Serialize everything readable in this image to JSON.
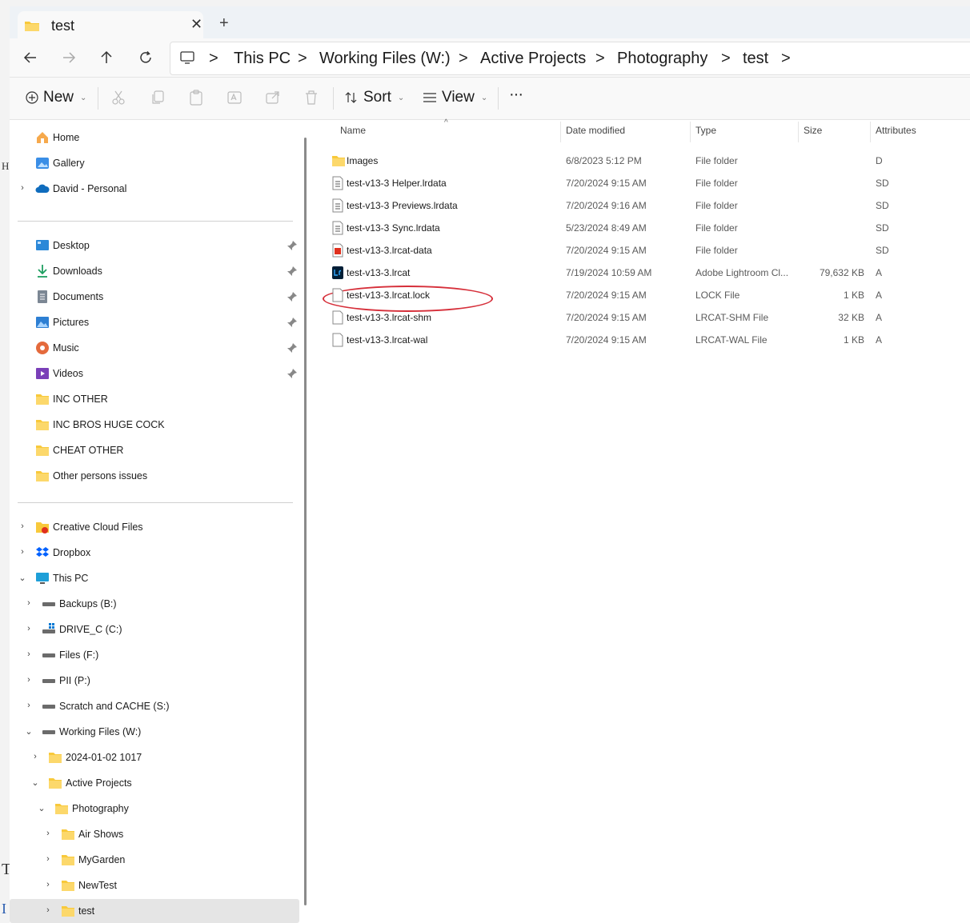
{
  "window": {
    "tab_title": "test",
    "tab_close": "✕",
    "new_tab": "+"
  },
  "addressbar": {
    "crumbs": [
      "This PC",
      "Working Files (W:)",
      "Active Projects",
      "Photography",
      "test"
    ],
    "sep": ">"
  },
  "commandbar": {
    "new_label": "New",
    "sort_label": "Sort",
    "view_label": "View",
    "more_label": "···"
  },
  "navpane": {
    "quick": [
      {
        "label": "Home",
        "icon": "home-icon"
      },
      {
        "label": "Gallery",
        "icon": "gallery-icon"
      },
      {
        "label": "David - Personal",
        "icon": "onedrive-icon"
      }
    ],
    "pinned": [
      {
        "label": "Desktop",
        "icon": "desktop-icon"
      },
      {
        "label": "Downloads",
        "icon": "downloads-icon"
      },
      {
        "label": "Documents",
        "icon": "documents-icon"
      },
      {
        "label": "Pictures",
        "icon": "pictures-icon"
      },
      {
        "label": "Music",
        "icon": "music-icon"
      },
      {
        "label": "Videos",
        "icon": "videos-icon"
      },
      {
        "label": "INC OTHER",
        "icon": "folder-icon"
      },
      {
        "label": "INC BROS HUGE COCK",
        "icon": "folder-icon"
      },
      {
        "label": "CHEAT OTHER",
        "icon": "folder-icon"
      },
      {
        "label": "Other persons issues",
        "icon": "folder-icon"
      }
    ],
    "tree": [
      {
        "label": "Creative Cloud Files",
        "icon": "creative-cloud-icon"
      },
      {
        "label": "Dropbox",
        "icon": "dropbox-icon"
      },
      {
        "label": "This PC",
        "icon": "this-pc-icon"
      },
      {
        "label": "Backups (B:)",
        "icon": "drive-icon"
      },
      {
        "label": "DRIVE_C (C:)",
        "icon": "windows-drive-icon"
      },
      {
        "label": "Files (F:)",
        "icon": "drive-icon"
      },
      {
        "label": "PII (P:)",
        "icon": "drive-icon"
      },
      {
        "label": "Scratch and CACHE (S:)",
        "icon": "drive-icon"
      },
      {
        "label": "Working Files (W:)",
        "icon": "drive-icon"
      },
      {
        "label": "2024-01-02 1017",
        "icon": "folder-icon"
      },
      {
        "label": "Active Projects",
        "icon": "folder-icon"
      },
      {
        "label": "Photography",
        "icon": "folder-icon"
      },
      {
        "label": "Air Shows",
        "icon": "folder-icon"
      },
      {
        "label": "MyGarden",
        "icon": "folder-icon"
      },
      {
        "label": "NewTest",
        "icon": "folder-icon"
      },
      {
        "label": "test",
        "icon": "folder-icon"
      }
    ]
  },
  "filelist": {
    "columns": [
      "Name",
      "Date modified",
      "Type",
      "Size",
      "Attributes"
    ],
    "rows": [
      {
        "name": "Images",
        "date": "6/8/2023 5:12 PM",
        "type": "File folder",
        "size": "",
        "attr": "D",
        "icon": "folder-icon"
      },
      {
        "name": "test-v13-3 Helper.lrdata",
        "date": "7/20/2024 9:15 AM",
        "type": "File folder",
        "size": "",
        "attr": "SD",
        "icon": "lrdata-icon"
      },
      {
        "name": "test-v13-3 Previews.lrdata",
        "date": "7/20/2024 9:16 AM",
        "type": "File folder",
        "size": "",
        "attr": "SD",
        "icon": "lrdata-icon"
      },
      {
        "name": "test-v13-3 Sync.lrdata",
        "date": "5/23/2024 8:49 AM",
        "type": "File folder",
        "size": "",
        "attr": "SD",
        "icon": "lrdata-icon"
      },
      {
        "name": "test-v13-3.lrcat-data",
        "date": "7/20/2024 9:15 AM",
        "type": "File folder",
        "size": "",
        "attr": "SD",
        "icon": "lrcat-data-icon"
      },
      {
        "name": "test-v13-3.lrcat",
        "date": "7/19/2024 10:59 AM",
        "type": "Adobe Lightroom Cl...",
        "size": "79,632 KB",
        "attr": "A",
        "icon": "lightroom-icon"
      },
      {
        "name": "test-v13-3.lrcat.lock",
        "date": "7/20/2024 9:15 AM",
        "type": "LOCK File",
        "size": "1 KB",
        "attr": "A",
        "icon": "file-icon"
      },
      {
        "name": "test-v13-3.lrcat-shm",
        "date": "7/20/2024 9:15 AM",
        "type": "LRCAT-SHM File",
        "size": "32 KB",
        "attr": "A",
        "icon": "file-icon"
      },
      {
        "name": "test-v13-3.lrcat-wal",
        "date": "7/20/2024 9:15 AM",
        "type": "LRCAT-WAL File",
        "size": "1 KB",
        "attr": "A",
        "icon": "file-icon"
      }
    ]
  },
  "background": {
    "letters": [
      "H",
      "T",
      "I"
    ]
  },
  "colors": {
    "folder": "#f8c93b",
    "callout": "#d62f3a",
    "selected": "#e5e5e5"
  }
}
